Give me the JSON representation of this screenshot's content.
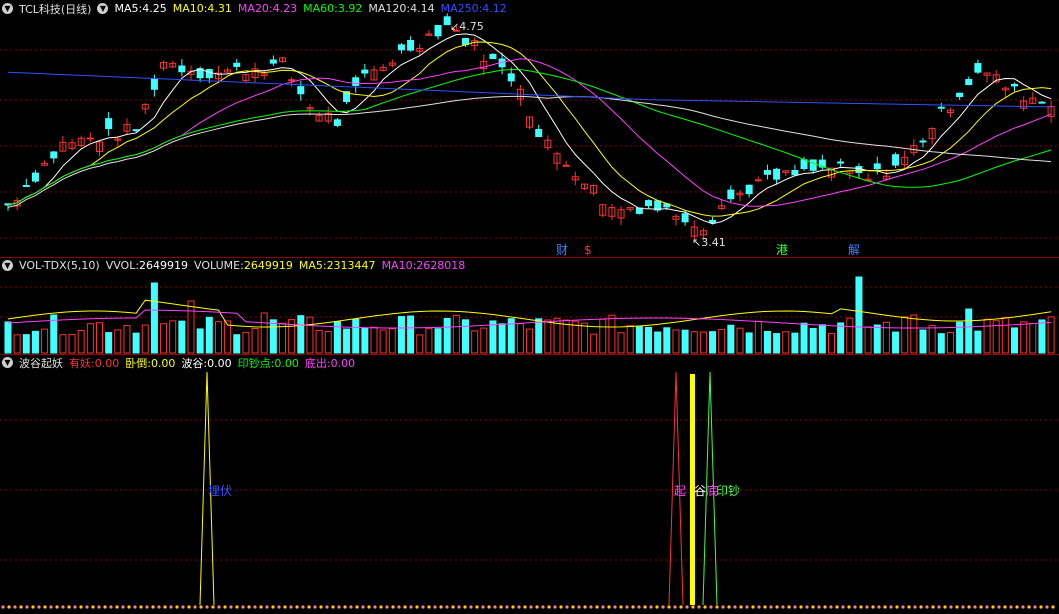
{
  "price_panel": {
    "title": "TCL科技(日线)",
    "legend": [
      {
        "label": "MA5: ",
        "value": "4.25",
        "color": "#ffffff"
      },
      {
        "label": "MA10: ",
        "value": "4.31",
        "color": "#ffff00"
      },
      {
        "label": "MA20: ",
        "value": "4.23",
        "color": "#ff40ff"
      },
      {
        "label": "MA60: ",
        "value": "3.92",
        "color": "#00ff00"
      },
      {
        "label": "MA120: ",
        "value": "4.14",
        "color": "#e0e0e0"
      },
      {
        "label": "MA250: ",
        "value": "4.12",
        "color": "#3050ff"
      }
    ],
    "high_label": "4.75",
    "low_label": "3.41",
    "markers": [
      {
        "text": "财",
        "color": "#4080ff"
      },
      {
        "text": "$",
        "color": "#ff3030"
      },
      {
        "text": "港",
        "color": "#40ff40"
      },
      {
        "text": "解",
        "color": "#4080ff"
      }
    ]
  },
  "volume_panel": {
    "title": "VOL-TDX(5,10)",
    "legend": [
      {
        "label": "VVOL: ",
        "value": "2649919",
        "color": "#ffffff"
      },
      {
        "label": "VOLUME: ",
        "value": "2649919",
        "color": "#ffff00"
      },
      {
        "label": "MA5: ",
        "value": "2313447",
        "color": "#ffff00"
      },
      {
        "label": "MA10: ",
        "value": "2628018",
        "color": "#ff40ff"
      }
    ]
  },
  "indicator_panel": {
    "title": "波谷起妖",
    "legend": [
      {
        "label": "有妖: ",
        "value": "0.00",
        "color": "#ff3030"
      },
      {
        "label": "卧倒: ",
        "value": "0.00",
        "color": "#ffff00"
      },
      {
        "label": "波谷: ",
        "value": "0.00",
        "color": "#ffffff"
      },
      {
        "label": "印钞点: ",
        "value": "0.00",
        "color": "#00ff00"
      },
      {
        "label": "底出: ",
        "value": "0.00",
        "color": "#ff40ff"
      }
    ],
    "signal_labels": [
      {
        "text": "埋伏",
        "color": "#3050ff"
      },
      {
        "text": "起",
        "color": "#ff40ff"
      },
      {
        "text": "谷",
        "color": "#ffffff"
      },
      {
        "text": "底",
        "color": "#ff40ff"
      },
      {
        "text": "印钞",
        "color": "#40ff40"
      }
    ]
  },
  "colors": {
    "up": "#ff3030",
    "down": "#40ffff",
    "grid": "#8b0000",
    "background": "#000000"
  }
}
